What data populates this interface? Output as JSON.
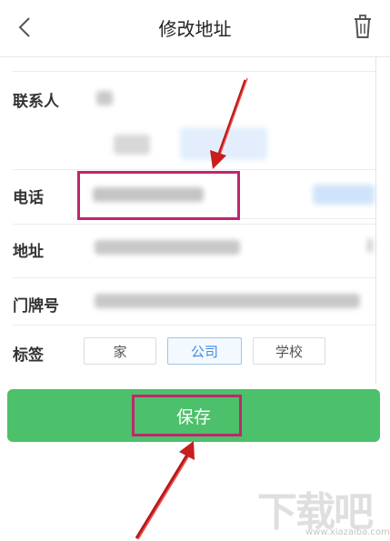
{
  "header": {
    "title": "修改地址",
    "back_icon": "chevron-left-icon",
    "delete_icon": "trash-icon"
  },
  "form": {
    "contact_label": "联系人",
    "phone_label": "电话",
    "address_label": "地址",
    "door_label": "门牌号",
    "tag_label": "标签"
  },
  "tags": {
    "items": [
      "家",
      "公司",
      "学校"
    ],
    "selected": "公司"
  },
  "save_label": "保存",
  "watermark": {
    "text": "下载吧",
    "url": "www.xiazaiba.com"
  },
  "colors": {
    "save_button": "#4cc06a",
    "highlight": "#c0266e",
    "tag_active": "#3a8ee6",
    "arrow": "#d42020"
  }
}
